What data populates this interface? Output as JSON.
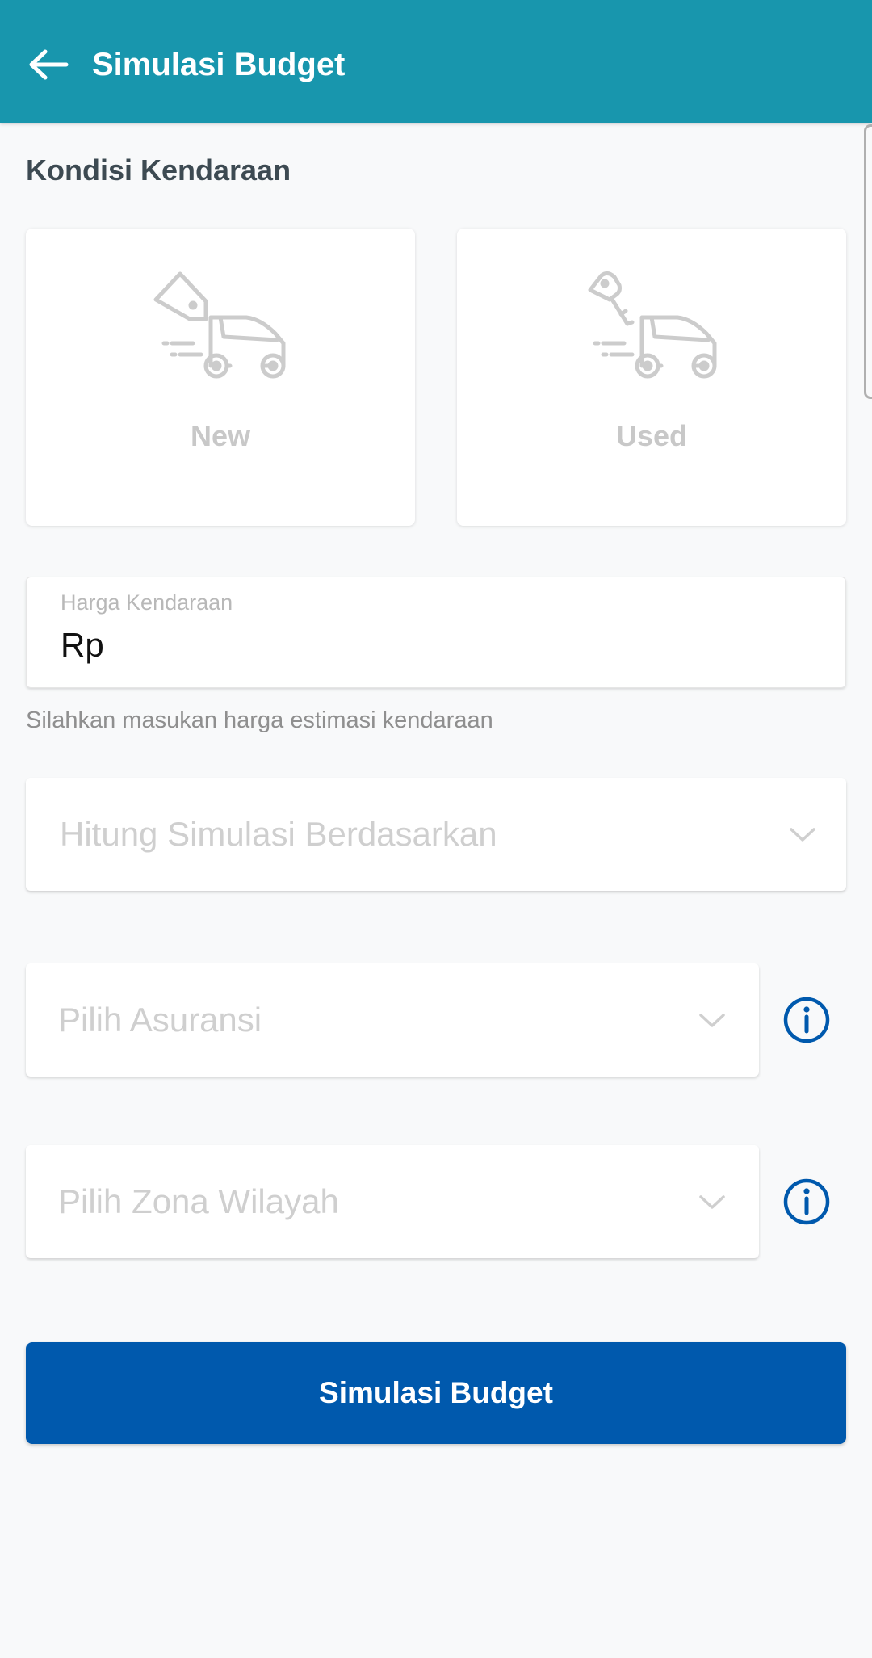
{
  "appbar": {
    "title": "Simulasi Budget",
    "back_icon": "arrow-left-icon",
    "background_color": "#1896ad"
  },
  "vehicle_condition": {
    "section_title": "Kondisi Kendaraan",
    "options": [
      {
        "label": "New",
        "icon": "new-car-tag-icon"
      },
      {
        "label": "Used",
        "icon": "used-car-key-icon"
      }
    ]
  },
  "price_input": {
    "floating_label": "Harga Kendaraan",
    "value": "Rp",
    "helper": "Silahkan masukan harga estimasi kendaraan"
  },
  "selects": {
    "calculation_basis": {
      "placeholder": "Hitung Simulasi Berdasarkan",
      "icon": "chevron-down-icon"
    },
    "insurance": {
      "placeholder": "Pilih Asuransi",
      "icon": "chevron-down-icon",
      "info_icon": "info-icon"
    },
    "zone": {
      "placeholder": "Pilih Zona Wilayah",
      "icon": "chevron-down-icon",
      "info_icon": "info-icon"
    }
  },
  "submit": {
    "label": "Simulasi Budget",
    "background_color": "#0059ad"
  }
}
